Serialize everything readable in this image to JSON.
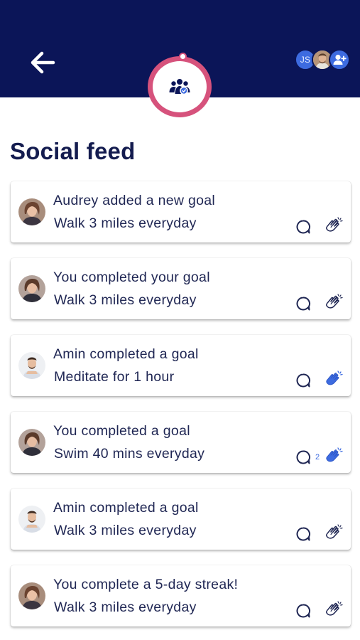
{
  "header": {
    "avatars": [
      {
        "initials": "JS"
      },
      {
        "name": "photo"
      },
      {
        "name": "add-person"
      }
    ]
  },
  "title": "Social feed",
  "colors": {
    "header": "#0b1558",
    "accent": "#d6527c",
    "blue": "#3d6be0",
    "text": "#1f2653"
  },
  "feed": [
    {
      "line1": "Audrey added a new goal",
      "line2": "Walk 3 miles everyday",
      "avatar": "woman",
      "clap": "outline",
      "clap_count": ""
    },
    {
      "line1": "You completed your goal",
      "line2": "Walk 3 miles everyday",
      "avatar": "woman",
      "clap": "outline",
      "clap_count": ""
    },
    {
      "line1": "Amin completed a goal",
      "line2": "Meditate for 1 hour",
      "avatar": "man",
      "clap": "filled",
      "clap_count": ""
    },
    {
      "line1": "You completed a goal",
      "line2": "Swim 40 mins everyday",
      "avatar": "woman",
      "clap": "filled",
      "clap_count": "2"
    },
    {
      "line1": "Amin completed a goal",
      "line2": "Walk 3 miles everyday",
      "avatar": "man",
      "clap": "outline",
      "clap_count": ""
    },
    {
      "line1": "You complete a 5-day streak!",
      "line2": "Walk 3 miles everyday",
      "avatar": "woman",
      "clap": "outline",
      "clap_count": ""
    }
  ]
}
